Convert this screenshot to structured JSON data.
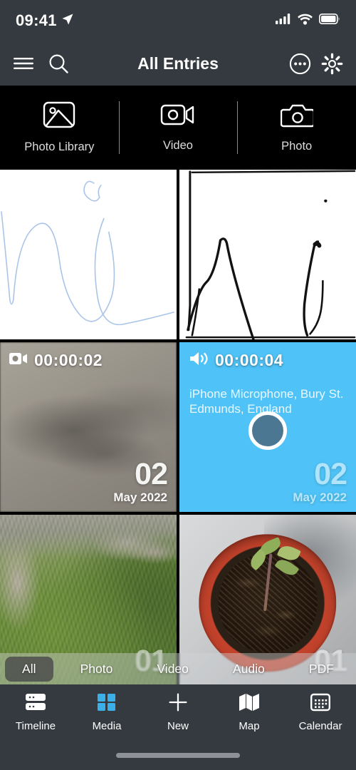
{
  "status_bar": {
    "time": "09:41",
    "location_icon": "location-arrow-icon",
    "cellular_icon": "cellular-bars-icon",
    "wifi_icon": "wifi-icon",
    "battery_icon": "battery-full-icon",
    "background": "#343a40"
  },
  "nav_bar": {
    "title": "All Entries",
    "menu_icon": "hamburger-menu-icon",
    "search_icon": "search-icon",
    "more_icon": "more-circle-icon",
    "settings_icon": "gear-icon",
    "background": "#343a40"
  },
  "capture_bar": {
    "background": "#000000",
    "items": [
      {
        "label": "Photo Library",
        "icon": "photo-library-icon"
      },
      {
        "label": "Video",
        "icon": "video-camera-icon"
      },
      {
        "label": "Photo",
        "icon": "camera-icon"
      }
    ]
  },
  "media_grid": {
    "columns": 2,
    "cells": [
      {
        "type": "sketch",
        "kind": "drawing",
        "ink_color": "#a8c4e8",
        "background": "#ffffff",
        "duration": "",
        "caption": "",
        "date_day": "",
        "date_month_year": ""
      },
      {
        "type": "sketch",
        "kind": "drawing",
        "ink_color": "#111111",
        "background": "#ffffff",
        "duration": "",
        "caption": "",
        "date_day": "",
        "date_month_year": ""
      },
      {
        "type": "video",
        "kind": "video",
        "icon": "video-camera-icon",
        "duration": "00:00:02",
        "caption": "",
        "date_day": "02",
        "date_month_year": "May 2022"
      },
      {
        "type": "audio",
        "kind": "audio",
        "icon": "speaker-wave-icon",
        "duration": "00:00:04",
        "caption": "iPhone Microphone, Bury St. Edmunds, England",
        "background": "#4fc3f7",
        "play_circle_color": "#4c7792",
        "date_day": "02",
        "date_month_year": "May 2022"
      },
      {
        "type": "photo",
        "kind": "photo-garden",
        "duration": "",
        "caption": "",
        "date_day": "01",
        "date_month_year": ""
      },
      {
        "type": "photo",
        "kind": "photo-plantpot",
        "duration": "",
        "caption": "",
        "date_day": "01",
        "date_month_year": ""
      }
    ]
  },
  "filter_bar": {
    "selected": "All",
    "items": [
      "All",
      "Photo",
      "Video",
      "Audio",
      "PDF"
    ]
  },
  "tab_bar": {
    "active": "Media",
    "active_color": "#3bafe8",
    "background": "#343a40",
    "items": [
      {
        "label": "Timeline",
        "icon": "timeline-rows-icon"
      },
      {
        "label": "Media",
        "icon": "media-grid-icon"
      },
      {
        "label": "New",
        "icon": "plus-icon"
      },
      {
        "label": "Map",
        "icon": "map-icon"
      },
      {
        "label": "Calendar",
        "icon": "calendar-icon"
      }
    ]
  }
}
